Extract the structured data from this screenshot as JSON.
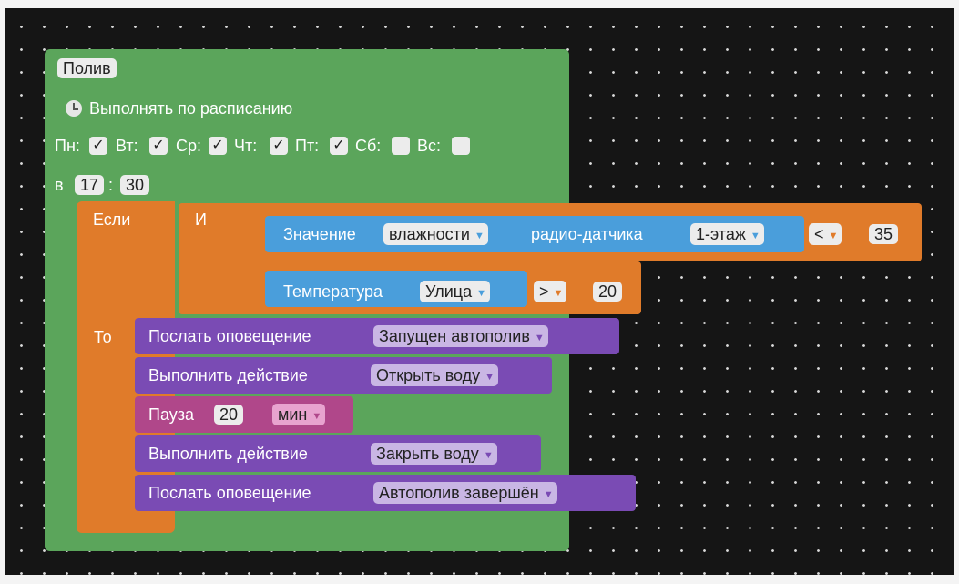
{
  "event": {
    "name": "Полив",
    "schedule_label": "Выполнять по расписанию",
    "days": [
      {
        "label": "Пн:",
        "checked": true
      },
      {
        "label": "Вт:",
        "checked": true
      },
      {
        "label": "Ср:",
        "checked": true
      },
      {
        "label": "Чт:",
        "checked": true
      },
      {
        "label": "Пт:",
        "checked": true
      },
      {
        "label": "Сб:",
        "checked": false
      },
      {
        "label": "Вс:",
        "checked": false
      }
    ],
    "check_mark": "✓",
    "time_prefix": "в",
    "time_separator": ":",
    "hour": "17",
    "minute": "30"
  },
  "if_block": {
    "if_label": "Если",
    "then_label": "То",
    "and_label": "И",
    "cond1": {
      "label1": "Значение",
      "param": "влажности",
      "label2": "радио-датчика",
      "sensor": "1-этаж",
      "op": "<",
      "value": "35"
    },
    "cond2": {
      "label": "Температура",
      "sensor": "Улица",
      "op": ">",
      "value": "20"
    }
  },
  "actions": [
    {
      "label": "Послать оповещение",
      "value": "Запущен автополив"
    },
    {
      "label": "Выполнить действие",
      "value": "Открыть воду"
    },
    {
      "label": "Пауза",
      "amount": "20",
      "unit": "мин"
    },
    {
      "label": "Выполнить действие",
      "value": "Закрыть воду"
    },
    {
      "label": "Послать оповещение",
      "value": "Автополив завершён"
    }
  ],
  "dropdown_arrow": "▼",
  "colors": {
    "workspace": "#151515",
    "event": "#5ba55b",
    "logic": "#e07b2a",
    "sensor": "#4a9edb",
    "action": "#7a4bb4",
    "pause": "#b0478a"
  }
}
